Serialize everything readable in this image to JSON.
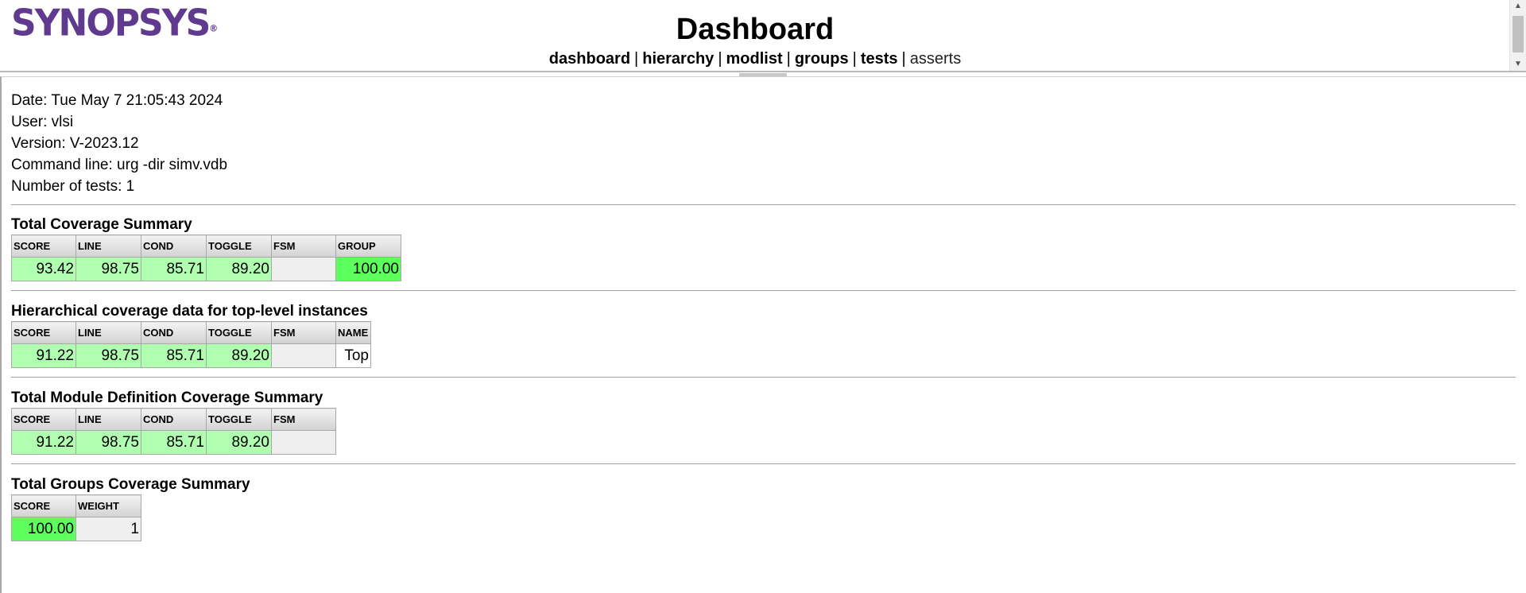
{
  "header": {
    "logo_text": "SYNOPSYS",
    "logo_mark": "®",
    "title": "Dashboard",
    "nav": [
      {
        "label": "dashboard",
        "bold": true
      },
      {
        "label": "hierarchy",
        "bold": true
      },
      {
        "label": "modlist",
        "bold": true
      },
      {
        "label": "groups",
        "bold": true
      },
      {
        "label": "tests",
        "bold": true
      },
      {
        "label": "asserts",
        "bold": false
      }
    ],
    "separator": "|"
  },
  "meta": {
    "date": "Date: Tue May 7 21:05:43 2024",
    "user": "User: vlsi",
    "version": "Version: V-2023.12",
    "command": "Command line: urg -dir simv.vdb",
    "tests": "Number of tests: 1"
  },
  "colors": {
    "good": "#b0ffb0",
    "full": "#5dff5d",
    "empty": "#efefef",
    "logo": "#5f3a8e"
  },
  "total_summary": {
    "title": "Total Coverage Summary",
    "headers": [
      "SCORE",
      "LINE",
      "COND",
      "TOGGLE",
      "FSM",
      "GROUP"
    ],
    "values": [
      "93.42",
      "98.75",
      "85.71",
      "89.20",
      "",
      "100.00"
    ]
  },
  "hier_summary": {
    "title": "Hierarchical coverage data for top-level instances",
    "headers": [
      "SCORE",
      "LINE",
      "COND",
      "TOGGLE",
      "FSM",
      "NAME"
    ],
    "values": [
      "91.22",
      "98.75",
      "85.71",
      "89.20",
      "",
      "Top"
    ]
  },
  "module_summary": {
    "title": "Total Module Definition Coverage Summary",
    "headers": [
      "SCORE",
      "LINE",
      "COND",
      "TOGGLE",
      "FSM"
    ],
    "values": [
      "91.22",
      "98.75",
      "85.71",
      "89.20",
      ""
    ]
  },
  "groups_summary": {
    "title": "Total Groups Coverage Summary",
    "headers": [
      "SCORE",
      "WEIGHT"
    ],
    "values": [
      "100.00",
      "1"
    ]
  }
}
